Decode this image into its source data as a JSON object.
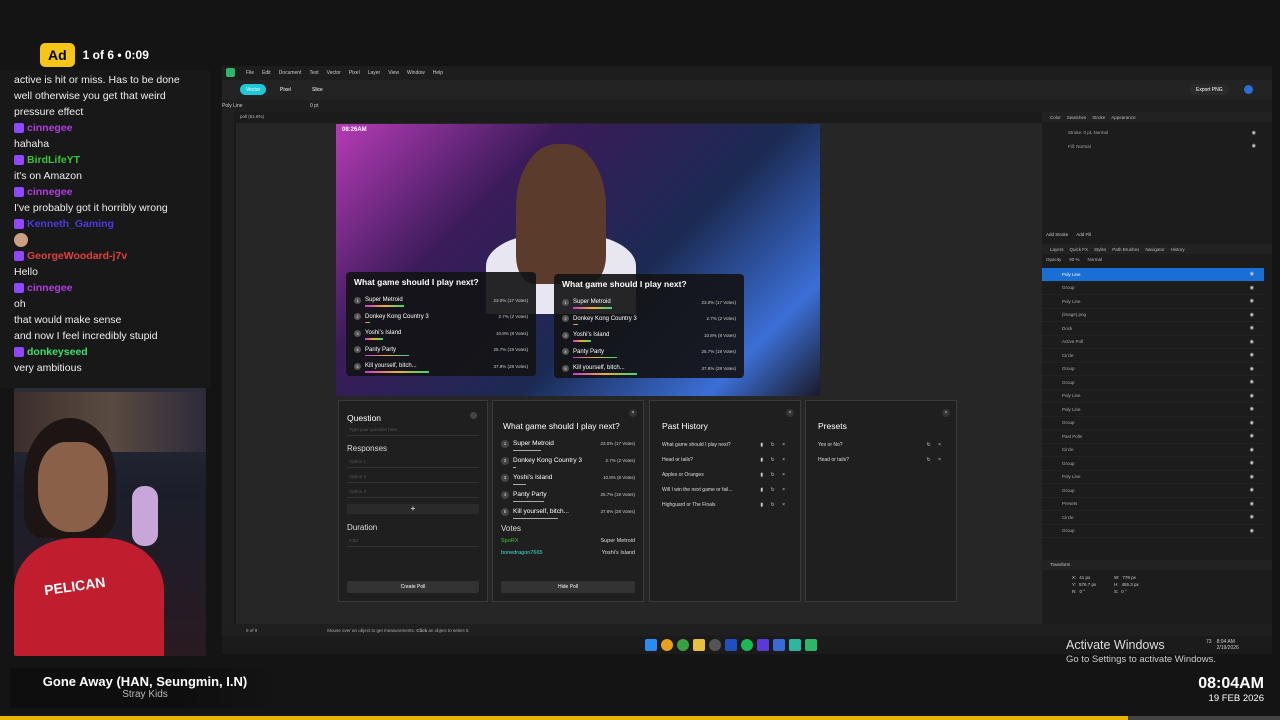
{
  "ad": {
    "label": "Ad",
    "counter": "1 of 6 • 0:09"
  },
  "chat": [
    {
      "kind": "msg",
      "text": "active is hit or miss. Has to be done well otherwise you get that weird pressure effect"
    },
    {
      "kind": "user",
      "name": "cinnegee",
      "color": "#b03fe0"
    },
    {
      "kind": "msg",
      "text": "hahaha"
    },
    {
      "kind": "user",
      "name": "BirdLifeYT",
      "color": "#3ac43a"
    },
    {
      "kind": "msg",
      "text": "it's on Amazon"
    },
    {
      "kind": "user",
      "name": "cinnegee",
      "color": "#b03fe0"
    },
    {
      "kind": "msg",
      "text": "I've probably got it horribly wrong"
    },
    {
      "kind": "user",
      "name": "Kenneth_Gaming",
      "color": "#4a3be0"
    },
    {
      "kind": "emote",
      "text": ""
    },
    {
      "kind": "user",
      "name": "GeorgeWoodard-j7v",
      "color": "#e04040"
    },
    {
      "kind": "msg",
      "text": "Hello"
    },
    {
      "kind": "user",
      "name": "cinnegee",
      "color": "#b03fe0"
    },
    {
      "kind": "msg",
      "text": "oh"
    },
    {
      "kind": "msg",
      "text": "that would make sense"
    },
    {
      "kind": "msg",
      "text": "and now I feel incredibly stupid"
    },
    {
      "kind": "user",
      "name": "donkeyseed",
      "color": "#3ae070"
    },
    {
      "kind": "msg",
      "text": "very ambitious"
    }
  ],
  "webcam": {
    "jersey_text": "PELICAN"
  },
  "now_playing": {
    "title": "Gone Away (HAN, Seungmin, I.N)",
    "artist": "Stray Kids"
  },
  "clock": {
    "time": "08:04AM",
    "date": "19 FEB 2026"
  },
  "app": {
    "menu": [
      "File",
      "Edit",
      "Document",
      "Text",
      "Vector",
      "Pixel",
      "Layer",
      "View",
      "Window",
      "Help"
    ],
    "toolbar": {
      "vector": "Vector",
      "pixel": "Pixel",
      "slice": "Slice",
      "export": "Export PNG"
    },
    "context": {
      "tool": "Poly Line",
      "width": "0 pt"
    },
    "doc_tab": "poll (61.6%)",
    "status": {
      "page": "9 of 9",
      "hint": "Mouse over an object to get measurements.",
      "click": "Click",
      "hint2": "an object to select it."
    }
  },
  "stream": {
    "timestamp": "08:26AM"
  },
  "poll": {
    "question": "What game should I play next?",
    "options": [
      {
        "name": "Super Metroid",
        "result": "23.0% (17 Votes)",
        "pct": 23.0
      },
      {
        "name": "Donkey Kong Country 3",
        "result": "2.7% (2 Votes)",
        "pct": 2.7
      },
      {
        "name": "Yoshi's Island",
        "result": "10.8% (8 Votes)",
        "pct": 10.8
      },
      {
        "name": "Panty Party",
        "result": "25.7% (19 Votes)",
        "pct": 25.7
      },
      {
        "name": "Kill yourself, bitch...",
        "result": "37.8% (28 Votes)",
        "pct": 37.8
      }
    ]
  },
  "panels": {
    "form": {
      "question_label": "Question",
      "question_ph": "Type your question here...",
      "responses_label": "Responses",
      "options": [
        "Option 1",
        "Option 2",
        "Option 3"
      ],
      "add": "+",
      "duration_label": "Duration",
      "duration_ph": "0:00",
      "create": "Create Poll"
    },
    "live": {
      "votes_label": "Votes",
      "votes": [
        {
          "user": "SpoRX",
          "choice": "Super Metroid",
          "color": "#3ac43a"
        },
        {
          "user": "bonedragon7665",
          "choice": "Yoshi's Island",
          "color": "#3ae0d0"
        }
      ],
      "hide": "Hide Poll"
    },
    "history": {
      "title": "Past History",
      "items": [
        "What game should I play next?",
        "Head or tails?",
        "Apples or Oranges",
        "Will I win the next game or fail...",
        "Highguard or The Finals"
      ]
    },
    "presets": {
      "title": "Presets",
      "items": [
        "Yes or No?",
        "Head or tails?"
      ]
    }
  },
  "right": {
    "tabs1": [
      "Color",
      "Swatches",
      "Stroke",
      "Appearance"
    ],
    "appearance": [
      "Stroke: 0 pt, Normal",
      "Fill: Normal"
    ],
    "add_stroke": "Add Stroke",
    "add_fill": "Add Fill",
    "tabs2": [
      "Layers",
      "Quick FX",
      "Styles",
      "Path Brushes",
      "Navigator",
      "History"
    ],
    "opacity": "Opacity",
    "opacity_val": "90 %",
    "blend": "Normal",
    "layers": [
      "Poly Line",
      "Group",
      "Poly Line",
      "(image).png",
      "Dock",
      "Active Poll",
      "Circle",
      "Group",
      "Group",
      "Poly Line",
      "Poly Line",
      "Group",
      "Past Polls",
      "Circle",
      "Group",
      "Poly Line",
      "Group",
      "Presets",
      "Circle",
      "Group"
    ],
    "transform_label": "Transform",
    "transform": [
      [
        "X:",
        "41 px"
      ],
      [
        "W:",
        "778 px"
      ],
      [
        "Y:",
        "576.7 px"
      ],
      [
        "H:",
        "455.3 px"
      ],
      [
        "R:",
        "0 °"
      ],
      [
        "S:",
        "0 °"
      ]
    ]
  },
  "windows": {
    "activate1": "Activate Windows",
    "activate2": "Go to Settings to activate Windows.",
    "tray_time": "8:04 AM",
    "tray_date": "2/19/2026",
    "tray_temp": "73"
  }
}
